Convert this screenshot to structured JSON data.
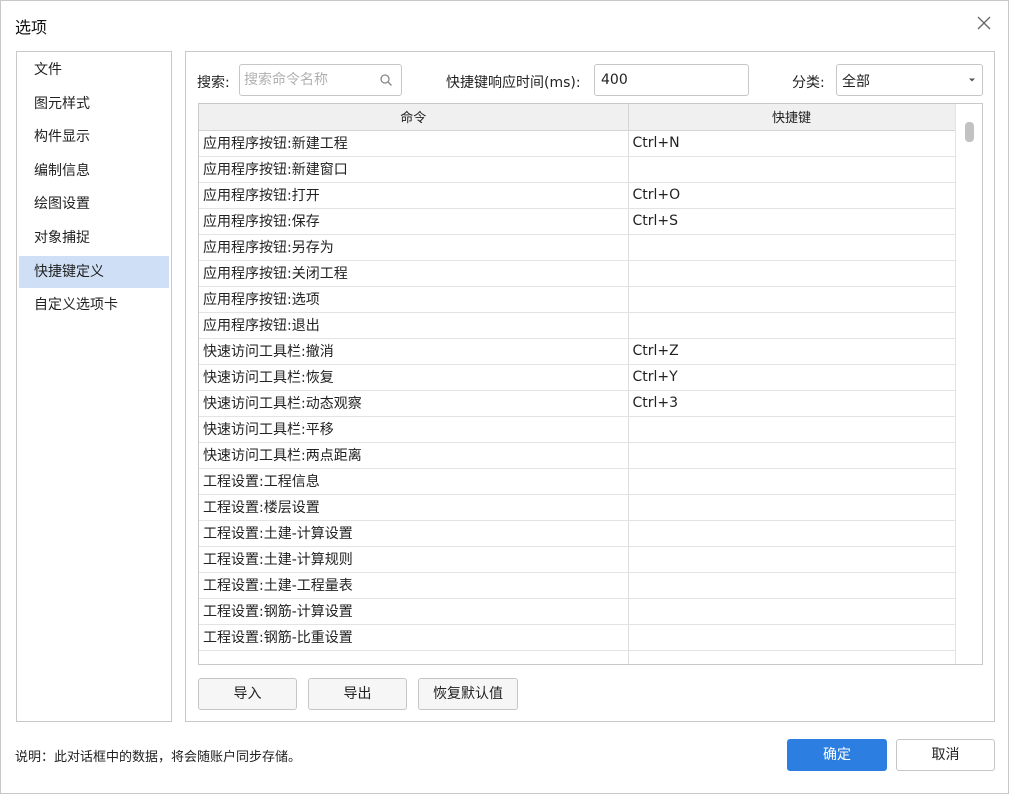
{
  "dialog": {
    "title": "选项",
    "close_icon": "close-icon"
  },
  "sidebar": {
    "items": [
      {
        "label": "文件",
        "active": false
      },
      {
        "label": "图元样式",
        "active": false
      },
      {
        "label": "构件显示",
        "active": false
      },
      {
        "label": "编制信息",
        "active": false
      },
      {
        "label": "绘图设置",
        "active": false
      },
      {
        "label": "对象捕捉",
        "active": false
      },
      {
        "label": "快捷键定义",
        "active": true
      },
      {
        "label": "自定义选项卡",
        "active": false
      }
    ]
  },
  "toolbar": {
    "search_label": "搜索:",
    "search_placeholder": "搜索命令名称",
    "search_value": "",
    "timeout_label": "快捷键响应时间(ms):",
    "timeout_value": "400",
    "category_label": "分类:",
    "category_value": "全部"
  },
  "table": {
    "headers": [
      "命令",
      "快捷键"
    ],
    "rows": [
      {
        "command": "应用程序按钮:新建工程",
        "shortcut": "Ctrl+N"
      },
      {
        "command": "应用程序按钮:新建窗口",
        "shortcut": ""
      },
      {
        "command": "应用程序按钮:打开",
        "shortcut": "Ctrl+O"
      },
      {
        "command": "应用程序按钮:保存",
        "shortcut": "Ctrl+S"
      },
      {
        "command": "应用程序按钮:另存为",
        "shortcut": ""
      },
      {
        "command": "应用程序按钮:关闭工程",
        "shortcut": ""
      },
      {
        "command": "应用程序按钮:选项",
        "shortcut": ""
      },
      {
        "command": "应用程序按钮:退出",
        "shortcut": ""
      },
      {
        "command": "快速访问工具栏:撤消",
        "shortcut": "Ctrl+Z"
      },
      {
        "command": "快速访问工具栏:恢复",
        "shortcut": "Ctrl+Y"
      },
      {
        "command": "快速访问工具栏:动态观察",
        "shortcut": "Ctrl+3"
      },
      {
        "command": "快速访问工具栏:平移",
        "shortcut": ""
      },
      {
        "command": "快速访问工具栏:两点距离",
        "shortcut": ""
      },
      {
        "command": "工程设置:工程信息",
        "shortcut": ""
      },
      {
        "command": "工程设置:楼层设置",
        "shortcut": ""
      },
      {
        "command": "工程设置:土建-计算设置",
        "shortcut": ""
      },
      {
        "command": "工程设置:土建-计算规则",
        "shortcut": ""
      },
      {
        "command": "工程设置:土建-工程量表",
        "shortcut": ""
      },
      {
        "command": "工程设置:钢筋-计算设置",
        "shortcut": ""
      },
      {
        "command": "工程设置:钢筋-比重设置",
        "shortcut": ""
      },
      {
        "command": "",
        "shortcut": ""
      }
    ]
  },
  "actions": {
    "import_label": "导入",
    "export_label": "导出",
    "restore_label": "恢复默认值"
  },
  "footer": {
    "note": "说明：此对话框中的数据，将会随账户同步存储。",
    "ok_label": "确定",
    "cancel_label": "取消"
  },
  "colors": {
    "accent": "#2c7fe0",
    "selected_item": "#cfe0f6"
  }
}
